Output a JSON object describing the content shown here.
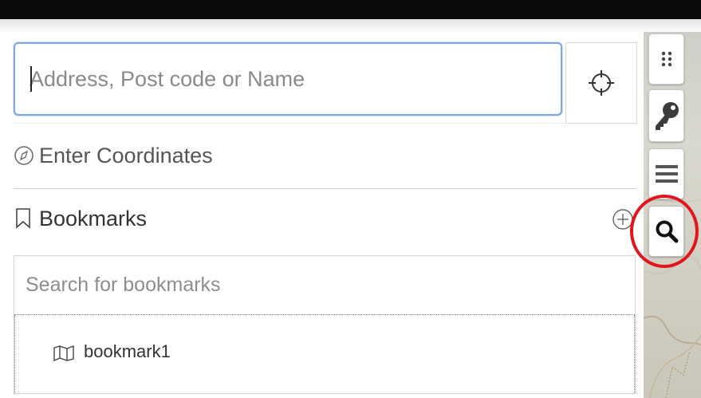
{
  "search": {
    "placeholder": "Address, Post code or Name",
    "value": ""
  },
  "locate_button": {
    "icon": "crosshair-icon"
  },
  "coordinates": {
    "label": "Enter Coordinates",
    "icon": "compass-icon"
  },
  "bookmarks": {
    "title": "Bookmarks",
    "icon": "bookmark-icon",
    "add_icon": "plus-circle-icon",
    "search_placeholder": "Search for bookmarks",
    "items": [
      {
        "label": "bookmark1",
        "icon": "map-icon"
      }
    ]
  },
  "toolbar": {
    "tools": [
      {
        "name": "grid",
        "icon": "grid-dots-icon"
      },
      {
        "name": "key",
        "icon": "key-icon"
      },
      {
        "name": "menu",
        "icon": "hamburger-menu-icon"
      },
      {
        "name": "search",
        "icon": "magnifier-icon",
        "highlighted": true
      }
    ]
  },
  "colors": {
    "input_focus": "#7aa7e8",
    "highlight": "#e0151d",
    "top_bar": "#0b0b0b"
  }
}
